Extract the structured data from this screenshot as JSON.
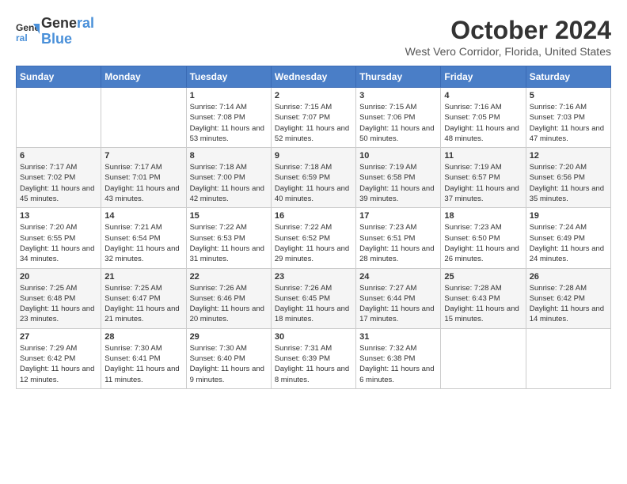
{
  "header": {
    "logo_line1": "General",
    "logo_line2": "Blue",
    "month": "October 2024",
    "location": "West Vero Corridor, Florida, United States"
  },
  "days_of_week": [
    "Sunday",
    "Monday",
    "Tuesday",
    "Wednesday",
    "Thursday",
    "Friday",
    "Saturday"
  ],
  "weeks": [
    [
      {
        "day": "",
        "sunrise": "",
        "sunset": "",
        "daylight": ""
      },
      {
        "day": "",
        "sunrise": "",
        "sunset": "",
        "daylight": ""
      },
      {
        "day": "1",
        "sunrise": "Sunrise: 7:14 AM",
        "sunset": "Sunset: 7:08 PM",
        "daylight": "Daylight: 11 hours and 53 minutes."
      },
      {
        "day": "2",
        "sunrise": "Sunrise: 7:15 AM",
        "sunset": "Sunset: 7:07 PM",
        "daylight": "Daylight: 11 hours and 52 minutes."
      },
      {
        "day": "3",
        "sunrise": "Sunrise: 7:15 AM",
        "sunset": "Sunset: 7:06 PM",
        "daylight": "Daylight: 11 hours and 50 minutes."
      },
      {
        "day": "4",
        "sunrise": "Sunrise: 7:16 AM",
        "sunset": "Sunset: 7:05 PM",
        "daylight": "Daylight: 11 hours and 48 minutes."
      },
      {
        "day": "5",
        "sunrise": "Sunrise: 7:16 AM",
        "sunset": "Sunset: 7:03 PM",
        "daylight": "Daylight: 11 hours and 47 minutes."
      }
    ],
    [
      {
        "day": "6",
        "sunrise": "Sunrise: 7:17 AM",
        "sunset": "Sunset: 7:02 PM",
        "daylight": "Daylight: 11 hours and 45 minutes."
      },
      {
        "day": "7",
        "sunrise": "Sunrise: 7:17 AM",
        "sunset": "Sunset: 7:01 PM",
        "daylight": "Daylight: 11 hours and 43 minutes."
      },
      {
        "day": "8",
        "sunrise": "Sunrise: 7:18 AM",
        "sunset": "Sunset: 7:00 PM",
        "daylight": "Daylight: 11 hours and 42 minutes."
      },
      {
        "day": "9",
        "sunrise": "Sunrise: 7:18 AM",
        "sunset": "Sunset: 6:59 PM",
        "daylight": "Daylight: 11 hours and 40 minutes."
      },
      {
        "day": "10",
        "sunrise": "Sunrise: 7:19 AM",
        "sunset": "Sunset: 6:58 PM",
        "daylight": "Daylight: 11 hours and 39 minutes."
      },
      {
        "day": "11",
        "sunrise": "Sunrise: 7:19 AM",
        "sunset": "Sunset: 6:57 PM",
        "daylight": "Daylight: 11 hours and 37 minutes."
      },
      {
        "day": "12",
        "sunrise": "Sunrise: 7:20 AM",
        "sunset": "Sunset: 6:56 PM",
        "daylight": "Daylight: 11 hours and 35 minutes."
      }
    ],
    [
      {
        "day": "13",
        "sunrise": "Sunrise: 7:20 AM",
        "sunset": "Sunset: 6:55 PM",
        "daylight": "Daylight: 11 hours and 34 minutes."
      },
      {
        "day": "14",
        "sunrise": "Sunrise: 7:21 AM",
        "sunset": "Sunset: 6:54 PM",
        "daylight": "Daylight: 11 hours and 32 minutes."
      },
      {
        "day": "15",
        "sunrise": "Sunrise: 7:22 AM",
        "sunset": "Sunset: 6:53 PM",
        "daylight": "Daylight: 11 hours and 31 minutes."
      },
      {
        "day": "16",
        "sunrise": "Sunrise: 7:22 AM",
        "sunset": "Sunset: 6:52 PM",
        "daylight": "Daylight: 11 hours and 29 minutes."
      },
      {
        "day": "17",
        "sunrise": "Sunrise: 7:23 AM",
        "sunset": "Sunset: 6:51 PM",
        "daylight": "Daylight: 11 hours and 28 minutes."
      },
      {
        "day": "18",
        "sunrise": "Sunrise: 7:23 AM",
        "sunset": "Sunset: 6:50 PM",
        "daylight": "Daylight: 11 hours and 26 minutes."
      },
      {
        "day": "19",
        "sunrise": "Sunrise: 7:24 AM",
        "sunset": "Sunset: 6:49 PM",
        "daylight": "Daylight: 11 hours and 24 minutes."
      }
    ],
    [
      {
        "day": "20",
        "sunrise": "Sunrise: 7:25 AM",
        "sunset": "Sunset: 6:48 PM",
        "daylight": "Daylight: 11 hours and 23 minutes."
      },
      {
        "day": "21",
        "sunrise": "Sunrise: 7:25 AM",
        "sunset": "Sunset: 6:47 PM",
        "daylight": "Daylight: 11 hours and 21 minutes."
      },
      {
        "day": "22",
        "sunrise": "Sunrise: 7:26 AM",
        "sunset": "Sunset: 6:46 PM",
        "daylight": "Daylight: 11 hours and 20 minutes."
      },
      {
        "day": "23",
        "sunrise": "Sunrise: 7:26 AM",
        "sunset": "Sunset: 6:45 PM",
        "daylight": "Daylight: 11 hours and 18 minutes."
      },
      {
        "day": "24",
        "sunrise": "Sunrise: 7:27 AM",
        "sunset": "Sunset: 6:44 PM",
        "daylight": "Daylight: 11 hours and 17 minutes."
      },
      {
        "day": "25",
        "sunrise": "Sunrise: 7:28 AM",
        "sunset": "Sunset: 6:43 PM",
        "daylight": "Daylight: 11 hours and 15 minutes."
      },
      {
        "day": "26",
        "sunrise": "Sunrise: 7:28 AM",
        "sunset": "Sunset: 6:42 PM",
        "daylight": "Daylight: 11 hours and 14 minutes."
      }
    ],
    [
      {
        "day": "27",
        "sunrise": "Sunrise: 7:29 AM",
        "sunset": "Sunset: 6:42 PM",
        "daylight": "Daylight: 11 hours and 12 minutes."
      },
      {
        "day": "28",
        "sunrise": "Sunrise: 7:30 AM",
        "sunset": "Sunset: 6:41 PM",
        "daylight": "Daylight: 11 hours and 11 minutes."
      },
      {
        "day": "29",
        "sunrise": "Sunrise: 7:30 AM",
        "sunset": "Sunset: 6:40 PM",
        "daylight": "Daylight: 11 hours and 9 minutes."
      },
      {
        "day": "30",
        "sunrise": "Sunrise: 7:31 AM",
        "sunset": "Sunset: 6:39 PM",
        "daylight": "Daylight: 11 hours and 8 minutes."
      },
      {
        "day": "31",
        "sunrise": "Sunrise: 7:32 AM",
        "sunset": "Sunset: 6:38 PM",
        "daylight": "Daylight: 11 hours and 6 minutes."
      },
      {
        "day": "",
        "sunrise": "",
        "sunset": "",
        "daylight": ""
      },
      {
        "day": "",
        "sunrise": "",
        "sunset": "",
        "daylight": ""
      }
    ]
  ]
}
